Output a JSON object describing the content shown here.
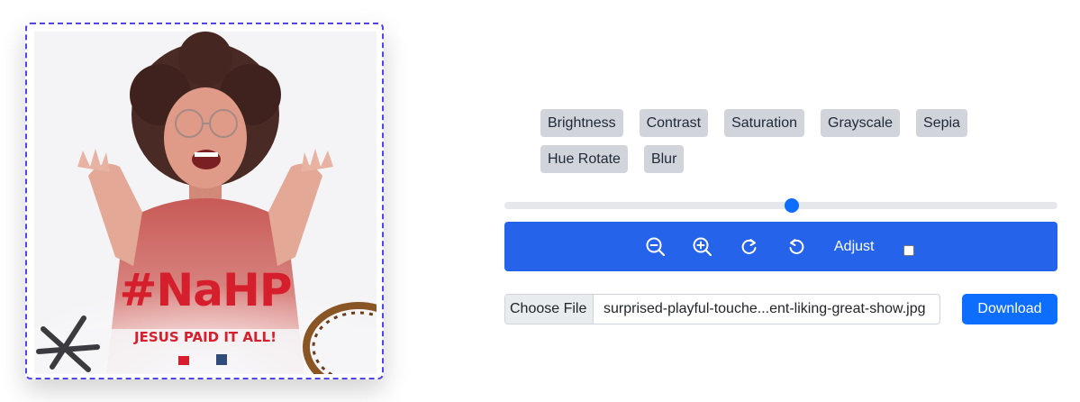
{
  "preview": {
    "poster_hashtag": "#NaHP",
    "poster_tagline": "JESUS PAID IT ALL!"
  },
  "filters": {
    "row1": [
      "Brightness",
      "Contrast",
      "Saturation",
      "Grayscale",
      "Sepia"
    ],
    "row2": [
      "Hue Rotate",
      "Blur"
    ]
  },
  "slider": {
    "value_fraction": 0.52
  },
  "toolbar": {
    "icons": [
      "zoom-out-icon",
      "zoom-in-icon",
      "rotate-right-icon",
      "rotate-left-icon"
    ],
    "adjust_label": "Adjust",
    "adjust_checked": false
  },
  "file": {
    "choose_label": "Choose File",
    "file_name": "surprised-playful-touche...ent-liking-great-show.jpg"
  },
  "download": {
    "label": "Download"
  },
  "colors": {
    "accent": "#2563eb",
    "primary_button": "#0d6efd",
    "filter_button": "#d1d5db",
    "frame_border": "#4f46e5",
    "poster_red": "#d61f2c"
  }
}
